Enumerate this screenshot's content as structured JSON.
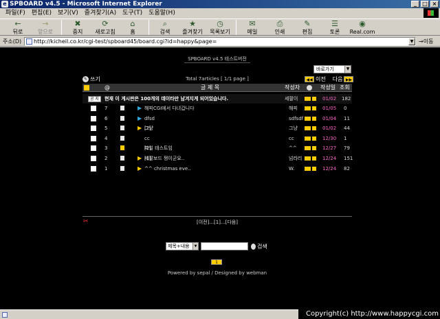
{
  "window": {
    "title": "SPBOARD v4.5 - Microsoft Internet Explorer",
    "buttons": [
      "_",
      "□",
      "×"
    ]
  },
  "menu": [
    "파일(F)",
    "편집(E)",
    "보기(V)",
    "즐겨찾기(A)",
    "도구(T)",
    "도움말(H)"
  ],
  "toolbar": [
    {
      "icon": "back-arrow-icon",
      "glyph": "←",
      "label": "뒤로",
      "enabled": true
    },
    {
      "icon": "forward-arrow-icon",
      "glyph": "→",
      "label": "앞으로",
      "enabled": false
    },
    {
      "icon": "stop-icon",
      "glyph": "✖",
      "label": "중지",
      "enabled": true
    },
    {
      "icon": "refresh-icon",
      "glyph": "⟳",
      "label": "새로고침",
      "enabled": true
    },
    {
      "icon": "home-icon",
      "glyph": "⌂",
      "label": "홈",
      "enabled": true
    },
    {
      "icon": "search-icon",
      "glyph": "⌕",
      "label": "검색",
      "enabled": true
    },
    {
      "icon": "favorites-icon",
      "glyph": "★",
      "label": "즐겨찾기",
      "enabled": true
    },
    {
      "icon": "history-icon",
      "glyph": "◷",
      "label": "목록보기",
      "enabled": true
    },
    {
      "icon": "mail-icon",
      "glyph": "✉",
      "label": "메일",
      "enabled": true
    },
    {
      "icon": "print-icon",
      "glyph": "⎙",
      "label": "인쇄",
      "enabled": true
    },
    {
      "icon": "edit-icon",
      "glyph": "✎",
      "label": "편집",
      "enabled": true
    },
    {
      "icon": "discuss-icon",
      "glyph": "☰",
      "label": "토론",
      "enabled": true
    },
    {
      "icon": "realcom-icon",
      "glyph": "◉",
      "label": "Real.com",
      "enabled": true
    }
  ],
  "address": {
    "label": "주소(D)",
    "url": "http://kicheil.co.kr/cgi-test/spboard45/board.cgi?id=happy&page=",
    "go_label": "이동"
  },
  "board": {
    "title": "SPBOARD v4.5 테스트버전",
    "jump_select": "바로가기",
    "total": "Total 7articles [ 1/1 page ]",
    "write_label": "쓰기",
    "prev_label": "이전",
    "next_label": "다음",
    "columns": {
      "at": "@",
      "subject": "글 제 목",
      "author": "작성자",
      "date": "작성일",
      "views": "조회"
    },
    "notice": {
      "badge": "공 지",
      "subject": "현재 이 게시판은 100개의 데이타만 남겨지게 되어있습니다.",
      "author": "세팔이",
      "date": "01/02",
      "views": "182"
    },
    "rows": [
      {
        "num": "7",
        "subject": "해피CGI에서 다녀갑니다",
        "comments": "",
        "author": "해피",
        "date": "01/05",
        "views": "0",
        "arrow": "blue"
      },
      {
        "num": "6",
        "subject": "dfsd",
        "comments": "",
        "author": "sdfsdf",
        "date": "01/04",
        "views": "11",
        "arrow": "blue"
      },
      {
        "num": "5",
        "subject": "그냥",
        "comments": "[2]",
        "author": "그냥",
        "date": "01/02",
        "views": "44",
        "arrow": "yellow"
      },
      {
        "num": "4",
        "subject": "cc",
        "comments": "",
        "author": "cc",
        "date": "12/30",
        "views": "1",
        "arrow": "none"
      },
      {
        "num": "3",
        "subject": "파일 테스트임",
        "comments": "[2]",
        "author": "^^",
        "date": "12/27",
        "views": "79",
        "arrow": "none"
      },
      {
        "num": "2",
        "subject": "세팔보드 쩡이군요..",
        "comments": "[1]",
        "author": "넘라리",
        "date": "12/24",
        "views": "151",
        "arrow": "yellow"
      },
      {
        "num": "1",
        "subject": "^^ christmas eve..",
        "comments": "",
        "author": "W.",
        "date": "12/24",
        "views": "82",
        "arrow": "yellow"
      }
    ],
    "pager": "[이전]...[1]...[다음]",
    "search_field": "제목+내용",
    "search_label": "검색",
    "page_badge": "1",
    "powered": "Powered by sepal / Designed by webman"
  },
  "copyright": "Copyright(c) http://www.happycgi.com"
}
